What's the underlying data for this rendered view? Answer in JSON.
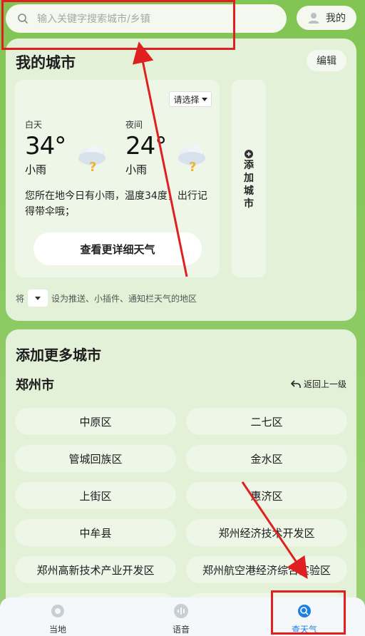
{
  "search": {
    "placeholder": "输入关键字搜索城市/乡镇"
  },
  "header": {
    "me_label": "我的"
  },
  "my_city": {
    "title": "我的城市",
    "edit_label": "编辑",
    "select_label": "请选择",
    "day": {
      "label": "白天",
      "temp": "34°",
      "condition": "小雨"
    },
    "night": {
      "label": "夜间",
      "temp": "24°",
      "condition": "小雨"
    },
    "description": "您所在地今日有小雨，温度34度，出行记得带伞哦；",
    "detail_button": "查看更详细天气",
    "add_city_label": "添加城市",
    "notice_prefix": "将",
    "notice_suffix": "设为推送、小插件、通知栏天气的地区"
  },
  "more_cities": {
    "title": "添加更多城市",
    "city": "郑州市",
    "back_label": "返回上一级",
    "districts": [
      "中原区",
      "二七区",
      "管城回族区",
      "金水区",
      "上街区",
      "惠济区",
      "中牟县",
      "郑州经济技术开发区",
      "郑州高新技术产业开发区",
      "郑州航空港经济综合实验区"
    ]
  },
  "nav": {
    "items": [
      {
        "label": "当地",
        "icon": "location-icon"
      },
      {
        "label": "语音",
        "icon": "voice-icon"
      },
      {
        "label": "查天气",
        "icon": "search-weather-icon"
      }
    ],
    "active_index": 2
  },
  "colors": {
    "background": "#82c554",
    "card": "#e3f1d8",
    "annotation": "#e02020",
    "nav_active": "#1e7fe0"
  }
}
